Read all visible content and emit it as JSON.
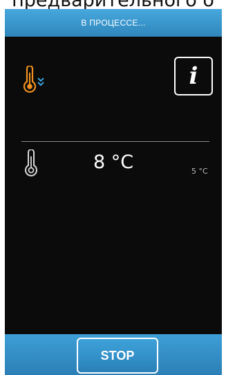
{
  "top_caption": "предварительного о",
  "header": {
    "title": "В ПРОЦЕССЕ..."
  },
  "mode": {
    "icon": "thermometer-cooling-icon",
    "accent_color": "#f0901e",
    "arrow_color": "#3aa3dd"
  },
  "info_button": {
    "label": "i",
    "icon": "info-icon"
  },
  "temperature": {
    "icon": "thermometer-icon",
    "current": "8 °C",
    "setpoint": "5 °C"
  },
  "footer": {
    "stop_label": "STOP"
  },
  "colors": {
    "header_blue": "#3a98d0",
    "screen_bg": "#0b0b0b"
  }
}
